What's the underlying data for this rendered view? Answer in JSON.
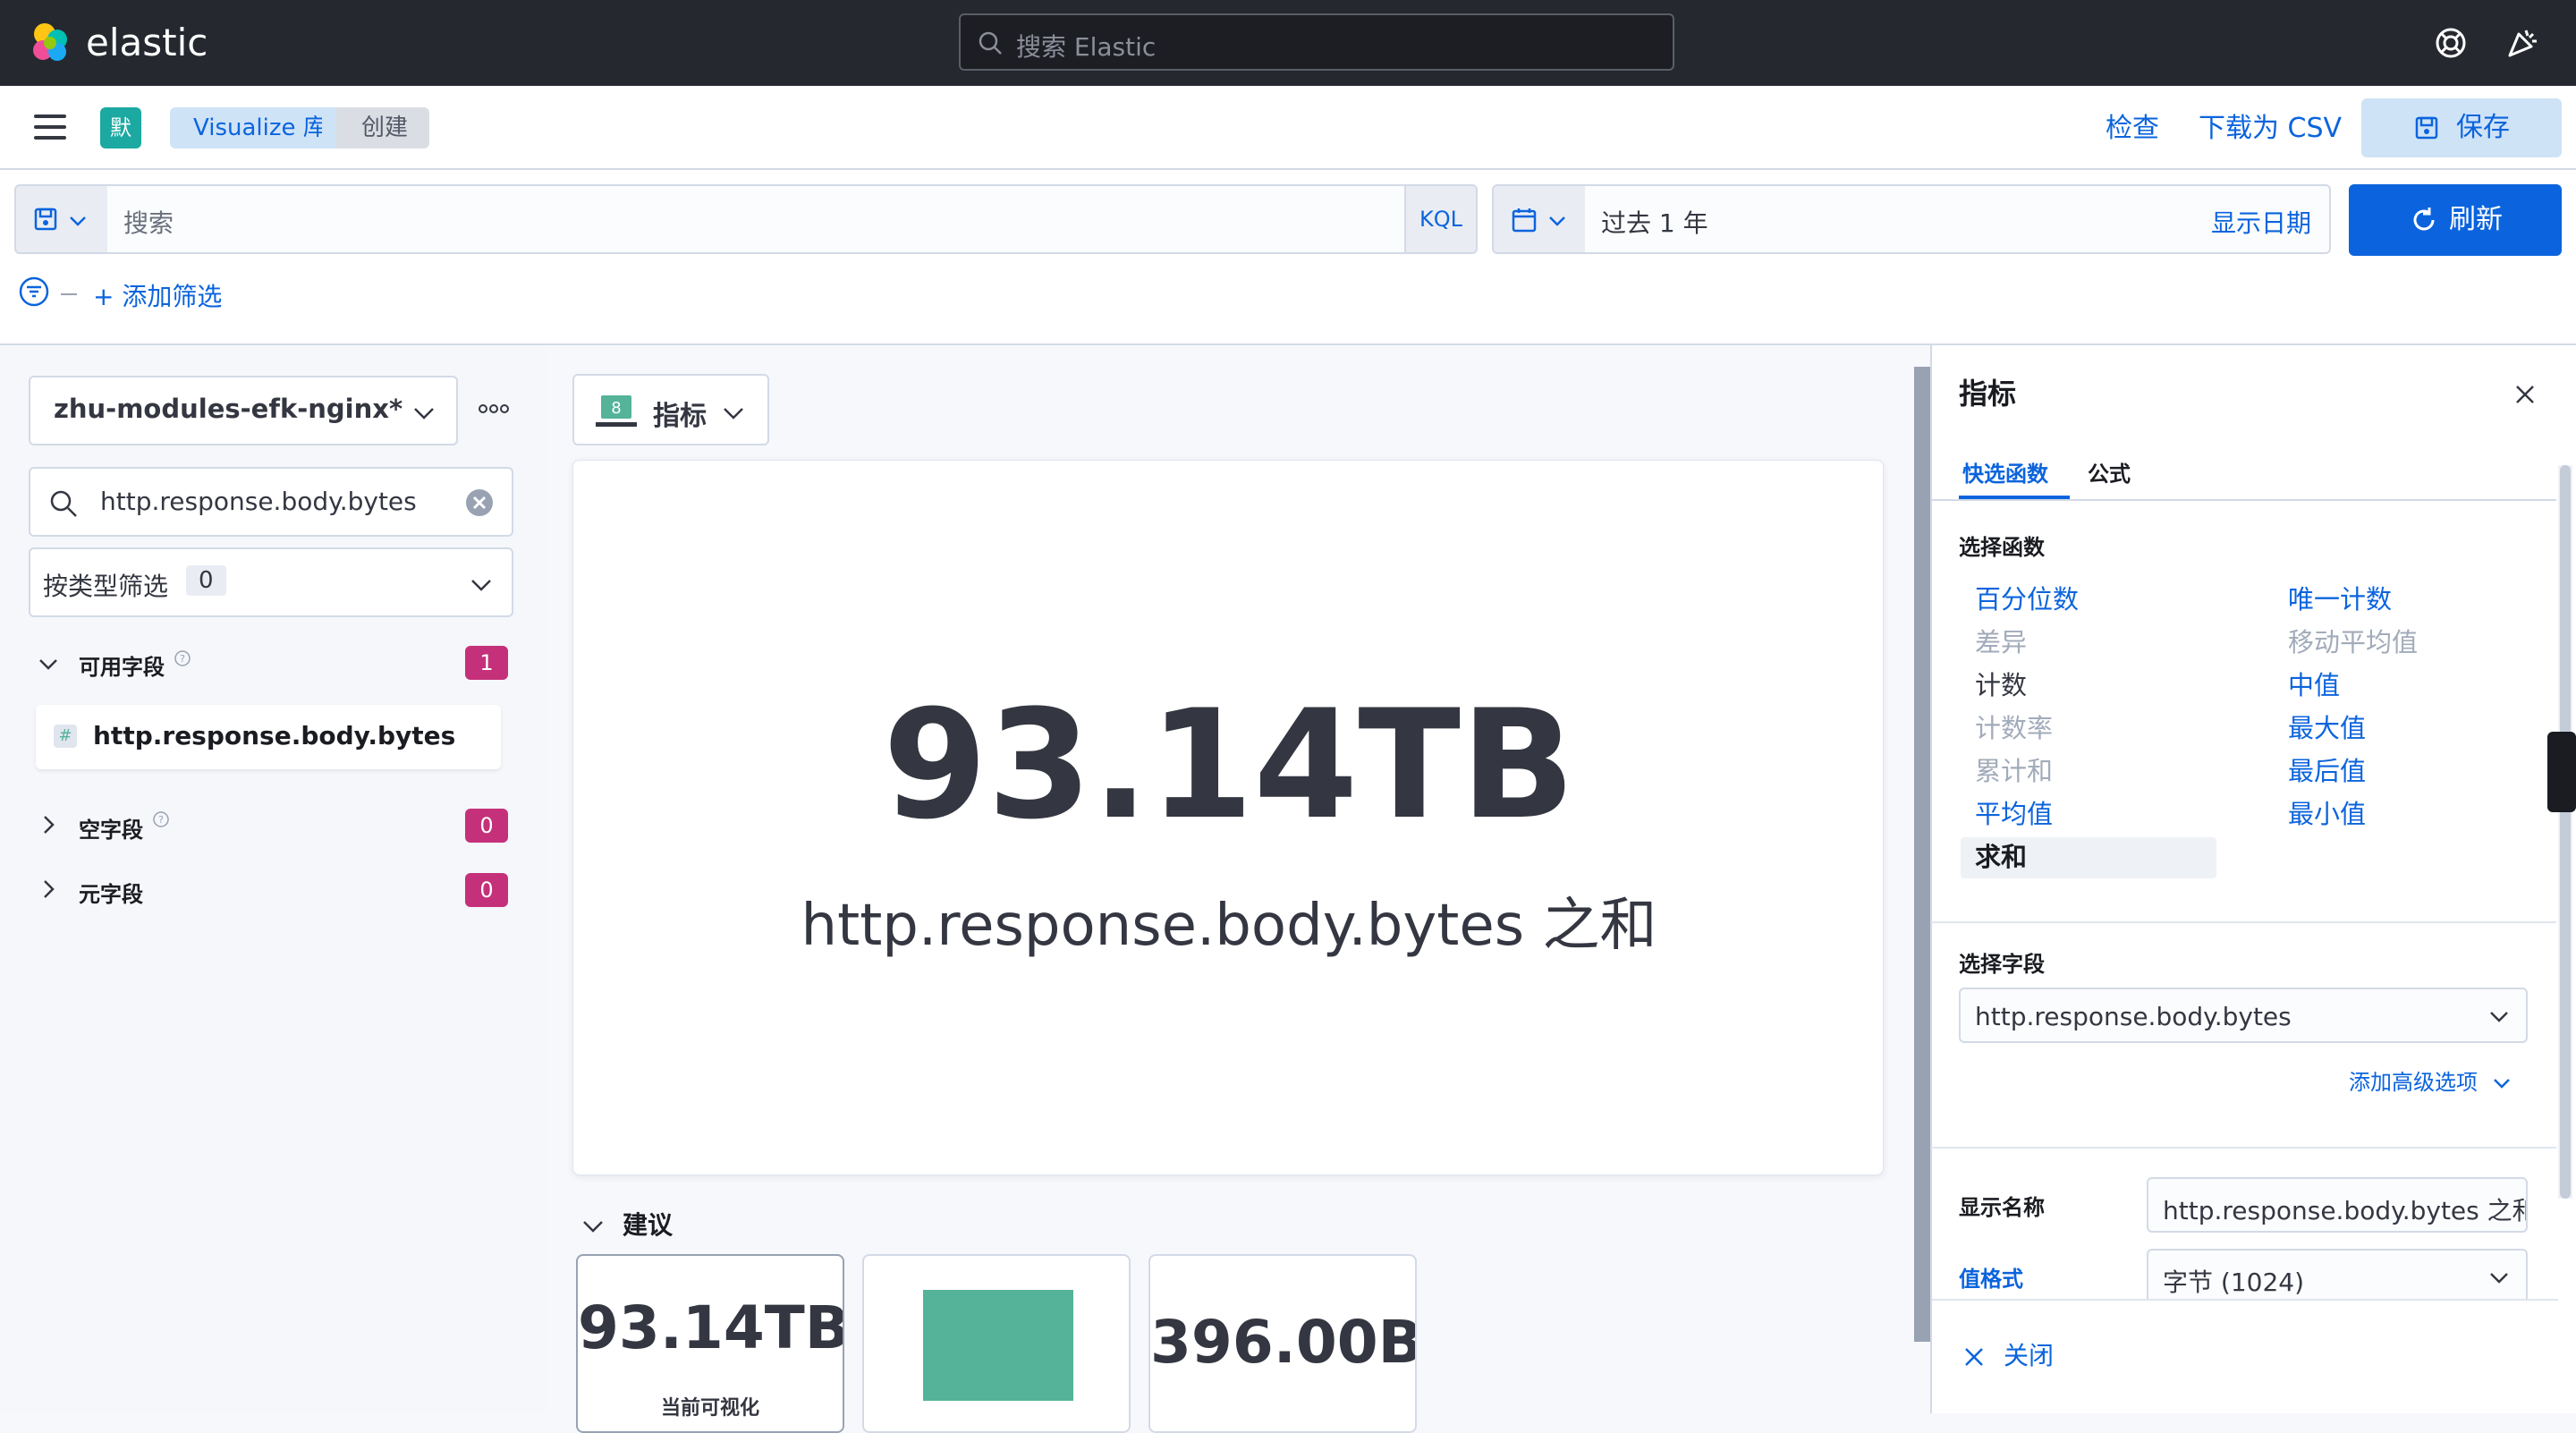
{
  "header": {
    "brand": "elastic",
    "search_placeholder": "搜索 Elastic"
  },
  "subbar": {
    "space_initial": "默",
    "breadcrumb": [
      "Visualize 库",
      "创建"
    ],
    "inspect": "检查",
    "download_csv": "下载为 CSV",
    "save": "保存"
  },
  "query": {
    "search_placeholder": "搜索",
    "language": "KQL",
    "date_range": "过去 1 年",
    "show_dates": "显示日期",
    "refresh": "刷新",
    "add_filter": "+ 添加筛选"
  },
  "left_panel": {
    "index_pattern": "zhu-modules-efk-nginx*",
    "field_search": "http.response.body.bytes",
    "type_filter_label": "按类型筛选",
    "type_filter_count": "0",
    "sections": [
      {
        "label": "可用字段",
        "count": "1"
      },
      {
        "label": "空字段",
        "count": "0"
      },
      {
        "label": "元字段",
        "count": "0"
      }
    ],
    "field_type": "#",
    "field_name": "http.response.body.bytes"
  },
  "workspace": {
    "chart_type": "指标",
    "chart_type_badge": "8",
    "metric_value": "93.14TB",
    "metric_label": "http.response.body.bytes 之和",
    "suggestions_head": "建议",
    "suggestion1_value": "93.14TB",
    "suggestion1_label": "当前可视化",
    "suggestion3_value": "396.00B",
    "bar_color": "#54b399"
  },
  "flyout": {
    "title": "指标",
    "tabs": [
      "快选函数",
      "公式"
    ],
    "functions_head": "选择函数",
    "functions_left": [
      {
        "label": "百分位数",
        "state": "active"
      },
      {
        "label": "差异",
        "state": "disabled"
      },
      {
        "label": "计数",
        "state": "plain"
      },
      {
        "label": "计数率",
        "state": "disabled"
      },
      {
        "label": "累计和",
        "state": "disabled"
      },
      {
        "label": "平均值",
        "state": "active"
      },
      {
        "label": "求和",
        "state": "selected"
      }
    ],
    "functions_right": [
      {
        "label": "唯一计数",
        "state": "active"
      },
      {
        "label": "移动平均值",
        "state": "disabled"
      },
      {
        "label": "中值",
        "state": "active"
      },
      {
        "label": "最大值",
        "state": "active"
      },
      {
        "label": "最后值",
        "state": "active"
      },
      {
        "label": "最小值",
        "state": "active"
      }
    ],
    "field_head": "选择字段",
    "field_value": "http.response.body.bytes",
    "advanced": "添加高级选项",
    "display_name_label": "显示名称",
    "display_name_value": "http.response.body.bytes 之和",
    "format_label": "值格式",
    "format_value": "字节 (1024)",
    "close": "关闭"
  },
  "colors": {
    "accent": "#0b64dd",
    "header_bg": "#25282f",
    "badge": "#c4317a"
  }
}
